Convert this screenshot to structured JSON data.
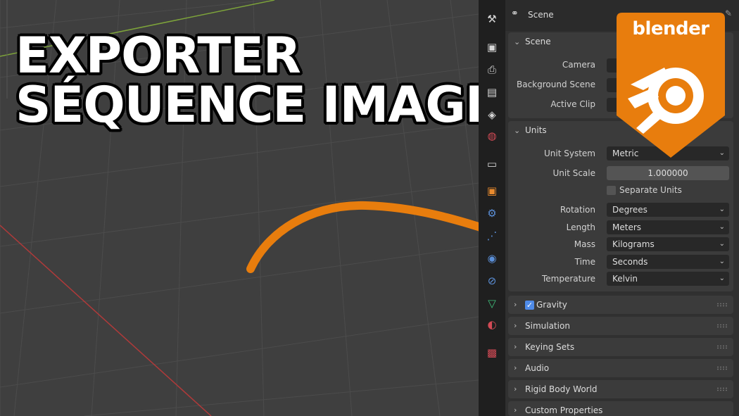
{
  "headline": {
    "line1": "EXPORTER",
    "line2": "SÉQUENCE IMAGES"
  },
  "logo": {
    "text": "blender"
  },
  "properties": {
    "header_title": "Scene",
    "scene_panel": {
      "title": "Scene",
      "rows": [
        {
          "label": "Camera"
        },
        {
          "label": "Background Scene"
        },
        {
          "label": "Active Clip"
        }
      ]
    },
    "units_panel": {
      "title": "Units",
      "unit_system": {
        "label": "Unit System",
        "value": "Metric"
      },
      "unit_scale": {
        "label": "Unit Scale",
        "value": "1.000000"
      },
      "separate_units": {
        "label": "Separate Units",
        "checked": false
      },
      "rotation": {
        "label": "Rotation",
        "value": "Degrees"
      },
      "length": {
        "label": "Length",
        "value": "Meters"
      },
      "mass": {
        "label": "Mass",
        "value": "Kilograms"
      },
      "time": {
        "label": "Time",
        "value": "Seconds"
      },
      "temperature": {
        "label": "Temperature",
        "value": "Kelvin"
      }
    },
    "collapsed_panels": [
      {
        "label": "Gravity",
        "checkbox": true
      },
      {
        "label": "Simulation"
      },
      {
        "label": "Keying Sets"
      },
      {
        "label": "Audio"
      },
      {
        "label": "Rigid Body World"
      },
      {
        "label": "Custom Properties"
      }
    ]
  },
  "toolstrip_icons": [
    "tool-icon",
    "render-icon",
    "output-icon",
    "view-layer-icon",
    "scene-icon",
    "world-icon",
    "collection-icon",
    "object-icon",
    "modifier-icon",
    "particles-icon",
    "physics-icon",
    "constraints-icon",
    "data-icon",
    "material-icon",
    "texture-icon"
  ],
  "colors": {
    "accent_orange": "#e87d0d",
    "checkbox_blue": "#4f8be8"
  }
}
